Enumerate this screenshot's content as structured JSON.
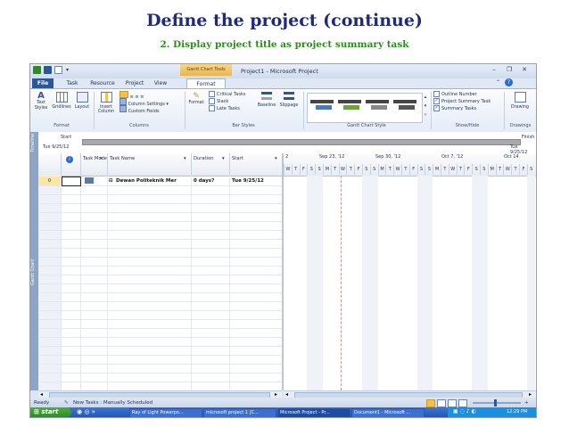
{
  "slide": {
    "title": "Define the project (continue)",
    "subtitle": "2. Display project title as project summary task"
  },
  "window": {
    "context_tab": "Gantt Chart Tools",
    "title": "Project1 - Microsoft Project",
    "controls": {
      "minimize": "–",
      "restore": "❐",
      "close": "✕"
    }
  },
  "tabs": [
    {
      "label": "File"
    },
    {
      "label": "Task"
    },
    {
      "label": "Resource"
    },
    {
      "label": "Project"
    },
    {
      "label": "View"
    },
    {
      "label": "Format"
    }
  ],
  "ribbon": {
    "format_group": {
      "label": "Format",
      "text_styles": "Text Styles",
      "gridlines": "Gridlines",
      "layout": "Layout"
    },
    "columns_group": {
      "label": "Columns",
      "insert_column": "Insert Column",
      "column_settings": "Column Settings",
      "custom_fields": "Custom Fields"
    },
    "bar_styles_group": {
      "label": "Bar Styles",
      "format": "Format",
      "critical_tasks": "Critical Tasks",
      "slack": "Slack",
      "late_tasks": "Late Tasks",
      "baseline": "Baseline",
      "slippage": "Slippage"
    },
    "chart_style_group": {
      "label": "Gantt Chart Style"
    },
    "show_hide_group": {
      "label": "Show/Hide",
      "outline_number": "Outline Number",
      "outline_number_checked": false,
      "project_summary_task": "Project Summary Task",
      "project_summary_task_checked": true,
      "summary_tasks": "Summary Tasks",
      "summary_tasks_checked": true
    },
    "drawings_group": {
      "label": "Drawings",
      "drawing": "Drawing"
    }
  },
  "timeline": {
    "side_label": "Timeline",
    "start_label": "Start",
    "start_date": "Tue 9/25/12",
    "finish_label": "Finish",
    "finish_date": "Tue 9/25/12"
  },
  "table": {
    "side_label": "Gantt Chart",
    "columns": [
      {
        "label": "Task Mode"
      },
      {
        "label": "Task Name"
      },
      {
        "label": "Duration"
      },
      {
        "label": "Start"
      }
    ],
    "rows": [
      {
        "id": "0",
        "name": "Dewan Politeknik Mer",
        "duration": "0 days?",
        "start": "Tue 9/25/12"
      }
    ]
  },
  "gantt": {
    "weeks": [
      "2",
      "Sep 23, '12",
      "Sep 30, '12",
      "Oct 7, '12",
      "Oct 14"
    ],
    "days": [
      "W",
      "T",
      "F",
      "S",
      "S",
      "M",
      "T",
      "W",
      "T",
      "F",
      "S",
      "S",
      "M",
      "T",
      "W",
      "T",
      "F",
      "S",
      "S",
      "M",
      "T",
      "W",
      "T",
      "F",
      "S",
      "S",
      "M",
      "T",
      "W",
      "T",
      "F",
      "S"
    ]
  },
  "status": {
    "ready": "Ready",
    "new_tasks": "New Tasks : Manually Scheduled"
  },
  "taskbar": {
    "start": "start",
    "items": [
      "Ray of Light Powerpo...",
      "microsoft project 1 [C...",
      "Microsoft Project - Pr...",
      "Document1 - Microsoft ..."
    ],
    "clock": "12:29 PM"
  },
  "colors": {
    "title": "#1f2b7a",
    "subtitle": "#2f8a1f",
    "file_tab": "#2b5797",
    "active_row": "#fbe6a4"
  }
}
